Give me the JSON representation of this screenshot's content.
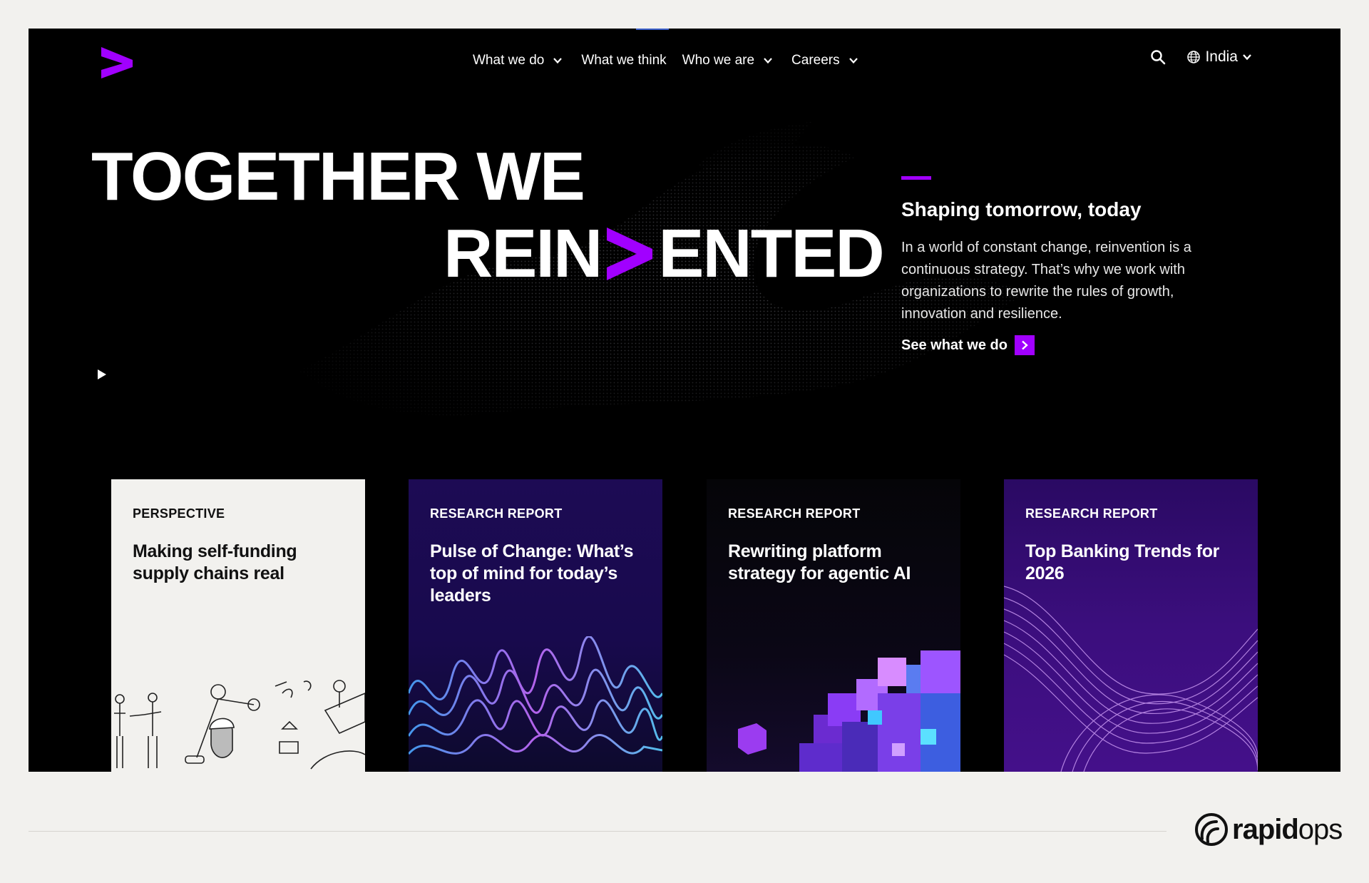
{
  "nav": {
    "items": [
      {
        "label": "What we do",
        "has_dropdown": true
      },
      {
        "label": "What we think",
        "has_dropdown": false
      },
      {
        "label": "Who we are",
        "has_dropdown": true
      },
      {
        "label": "Careers",
        "has_dropdown": true
      }
    ],
    "search_icon": "search-icon",
    "country": "India"
  },
  "hero": {
    "line1": "TOGETHER WE",
    "line2_before": "REIN",
    "line2_after": "ENTED",
    "subtitle": "Shaping tomorrow, today",
    "description": "In a world of constant change, reinvention is a continuous strategy. That’s why we work with organizations to rewrite the rules of growth, innovation and resilience.",
    "cta_label": "See what we do"
  },
  "cards": [
    {
      "tag": "PERSPECTIVE",
      "title": "Making self-funding supply chains real"
    },
    {
      "tag": "RESEARCH REPORT",
      "title": "Pulse of Change: What’s top of mind for today’s leaders"
    },
    {
      "tag": "RESEARCH REPORT",
      "title": "Rewriting platform strategy for agentic AI"
    },
    {
      "tag": "RESEARCH REPORT",
      "title": "Top Banking Trends for 2026"
    }
  ],
  "footer": {
    "brand_bold": "rapid",
    "brand_light": "ops"
  },
  "colors": {
    "accent": "#a100ff",
    "frame_bg": "#000000",
    "page_bg": "#f2f1ee"
  }
}
